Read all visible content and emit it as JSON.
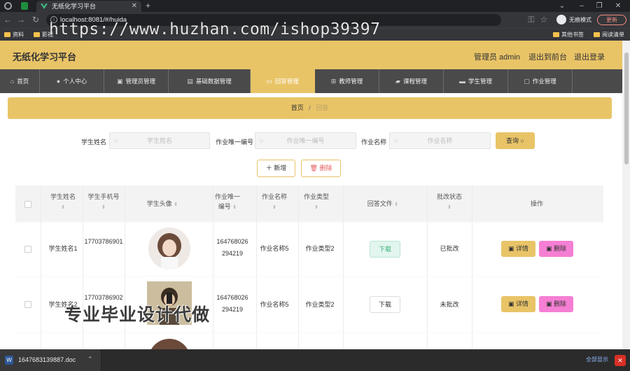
{
  "browser": {
    "tab_title": "无纸化学习平台",
    "url": "localhost:8081/#/huida",
    "bookmarks": [
      "资料",
      "影视"
    ],
    "bookmarks_right": [
      "其他书签",
      "阅读清单"
    ],
    "incognito_label": "无痕模式",
    "update_label": "更新"
  },
  "watermark_url": "https://www.huzhan.com/ishop39397",
  "watermark_text": "专业毕业设计代做",
  "header": {
    "title": "无纸化学习平台",
    "admin": "管理员 admin",
    "back_to_front": "退出到前台",
    "logout": "退出登录"
  },
  "nav": [
    {
      "label": "首页",
      "icon": "home-icon"
    },
    {
      "label": "个人中心",
      "icon": "user-icon"
    },
    {
      "label": "管理员管理",
      "icon": "folder-icon"
    },
    {
      "label": "基础数据管理",
      "icon": "file-icon"
    },
    {
      "label": "回答管理",
      "icon": "card-icon"
    },
    {
      "label": "教师管理",
      "icon": "grid-icon"
    },
    {
      "label": "课程管理",
      "icon": "layer-icon"
    },
    {
      "label": "学生管理",
      "icon": "id-icon"
    },
    {
      "label": "作业管理",
      "icon": "monitor-icon"
    }
  ],
  "breadcrumb": {
    "home": "首页",
    "sep": "/",
    "current": "回答"
  },
  "search": {
    "fields": [
      {
        "label": "学生姓名",
        "placeholder": "学生姓名"
      },
      {
        "label": "作业唯一编号",
        "placeholder": "作业唯一编号"
      },
      {
        "label": "作业名称",
        "placeholder": "作业名称"
      }
    ],
    "query_label": "查询"
  },
  "actions": {
    "add_label": "新增",
    "delete_label": "删除"
  },
  "table": {
    "columns": [
      "学生姓名",
      "学生手机号",
      "学生头像",
      "作业唯一编号",
      "作业名称",
      "作业类型",
      "回答文件",
      "批改状态",
      "操作"
    ],
    "rows": [
      {
        "name": "学生姓名1",
        "phone": "17703786901",
        "code": "164768026294219",
        "hw": "作业名称5",
        "type": "作业类型2",
        "file": "下载",
        "status": "已批改",
        "detail": "详情",
        "del": "删除"
      },
      {
        "name": "学生姓名2",
        "phone": "17703786902",
        "code": "164768026294219",
        "hw": "作业名称5",
        "type": "作业类型2",
        "file": "下载",
        "status": "未批改",
        "detail": "详情",
        "del": "删除"
      }
    ]
  },
  "taskbar": {
    "file": "1647683139887.doc",
    "show_all": "全部显示"
  },
  "colors": {
    "accent": "#e9c467",
    "nav_bg": "#4a4a4a",
    "pink": "#f57fd3"
  }
}
